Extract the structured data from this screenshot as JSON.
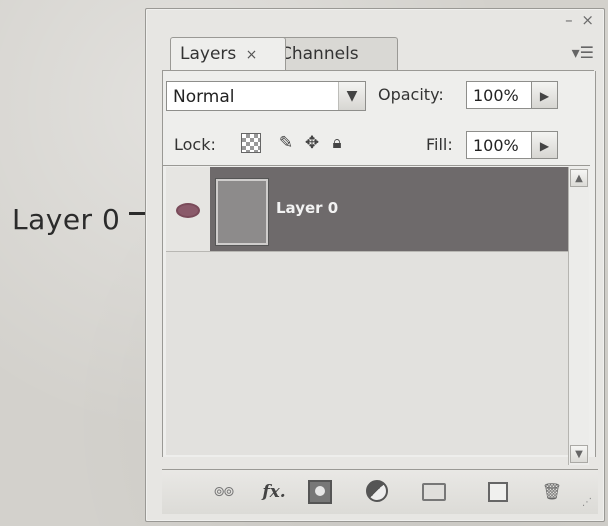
{
  "callout": {
    "label": "Layer 0"
  },
  "panel": {
    "window_controls": {
      "minimize": "–",
      "close": "×"
    },
    "tabs": [
      {
        "label": "Layers",
        "close": "×",
        "active": true
      },
      {
        "label": "Channels",
        "active": false
      }
    ],
    "menu_icon": "panel-menu-icon",
    "menu_glyph": "▾☰"
  },
  "blend_mode": {
    "value": "Normal"
  },
  "opacity": {
    "label": "Opacity:",
    "value": "100%"
  },
  "lock": {
    "label": "Lock:",
    "icons": [
      "lock-transparent-pixels-icon",
      "lock-image-pixels-icon",
      "lock-position-icon",
      "lock-all-icon"
    ]
  },
  "fill": {
    "label": "Fill:",
    "value": "100%"
  },
  "layers": [
    {
      "name": "Layer 0",
      "visible": true,
      "selected": true
    }
  ],
  "bottom_toolbar": {
    "buttons": [
      {
        "name": "link-layers-icon",
        "glyph": "⊚⊚"
      },
      {
        "name": "add-layer-style-icon",
        "glyph": "fx."
      },
      {
        "name": "add-layer-mask-icon",
        "glyph": ""
      },
      {
        "name": "new-adjustment-layer-icon",
        "glyph": ""
      },
      {
        "name": "new-group-icon",
        "glyph": ""
      },
      {
        "name": "new-layer-icon",
        "glyph": ""
      },
      {
        "name": "delete-layer-icon",
        "glyph": "🗑"
      }
    ]
  },
  "colors": {
    "selected_row": "#6e6a6b",
    "panel_bg": "#e7e6e3",
    "eye_icon": "#8a5a6a"
  }
}
